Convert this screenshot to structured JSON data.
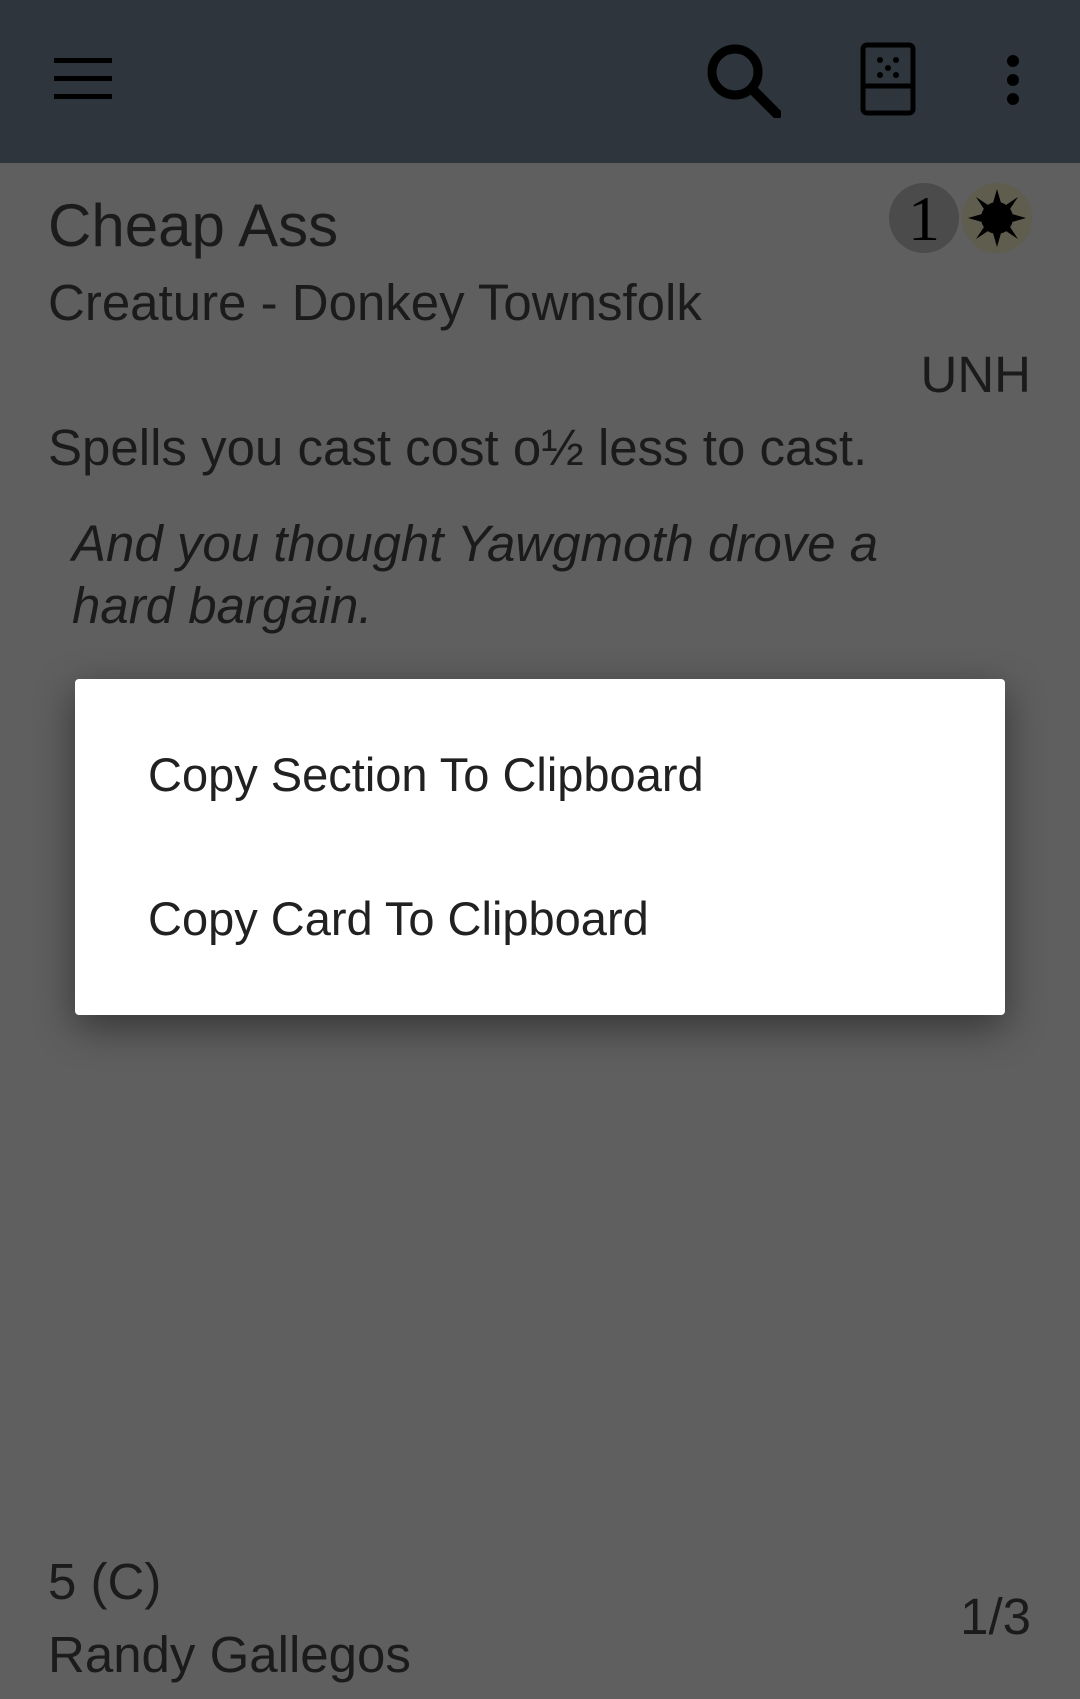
{
  "toolbar": {
    "icons": [
      "menu-icon",
      "search-icon",
      "deck-icon",
      "more-vert-icon"
    ]
  },
  "card": {
    "name": "Cheap Ass",
    "type_line": "Creature - Donkey Townsfolk",
    "mana_cost": {
      "generic": "1",
      "color_symbol": "white-mana-icon"
    },
    "set_code": "UNH",
    "rules_text": "Spells you cast cost o½ less to cast.",
    "flavor_text": "And you thought Yawgmoth drove a hard bargain.",
    "collector_number": "5 (C)",
    "artist": "Randy Gallegos",
    "power_toughness": "1/3"
  },
  "dialog": {
    "items": [
      {
        "label": "Copy Section To Clipboard"
      },
      {
        "label": "Copy Card To Clipboard"
      }
    ]
  },
  "colors": {
    "toolbar_bg": "#2e353c",
    "scrim_bg": "#5f5f5f",
    "dialog_bg": "#ffffff"
  }
}
